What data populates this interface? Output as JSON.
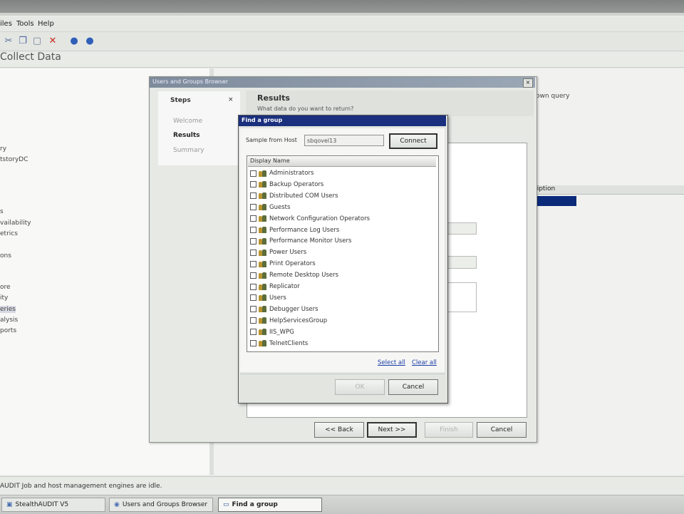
{
  "menu": {
    "items": [
      "iles",
      "Tools",
      "Help"
    ]
  },
  "toolbar": {
    "icons": [
      "cut-icon",
      "copy-icon",
      "paste-icon",
      "delete-icon",
      "back-circle-icon",
      "forward-circle-icon"
    ]
  },
  "page": {
    "title": "Collect Data"
  },
  "left_tree": {
    "items": [
      "ry",
      "tstoryDC",
      "s",
      "vailability",
      "etrics",
      "ons",
      "ore",
      "ity",
      "eries",
      "alysis",
      "ports"
    ]
  },
  "right_panel": {
    "snippet": "own query",
    "header_label": "ription"
  },
  "wizard": {
    "title": "Users and Groups Browser",
    "close_glyph": "×",
    "steps_header": "Steps",
    "steps_close": "×",
    "steps": [
      "Welcome",
      "Results",
      "Summary"
    ],
    "results_heading": "Results",
    "results_sub": "What data do you want to return?",
    "buttons": {
      "back": "<< Back",
      "next": "Next >>",
      "finish": "Finish",
      "cancel": "Cancel"
    }
  },
  "find_group": {
    "title": "Find a group",
    "host_label": "Sample from Host",
    "host_value": "sbqovel13",
    "connect_label": "Connect",
    "list_header": "Display Name",
    "groups": [
      "Administrators",
      "Backup Operators",
      "Distributed COM Users",
      "Guests",
      "Network Configuration Operators",
      "Performance Log Users",
      "Performance Monitor Users",
      "Power Users",
      "Print Operators",
      "Remote Desktop Users",
      "Replicator",
      "Users",
      "Debugger Users",
      "HelpServicesGroup",
      "IIS_WPG",
      "TelnetClients"
    ],
    "select_all": "Select all",
    "clear_all": "Clear all",
    "ok_label": "OK",
    "cancel_label": "Cancel"
  },
  "status": {
    "text": "AUDIT Job and host management engines are idle."
  },
  "taskbar": {
    "items": [
      {
        "label": "StealthAUDIT V5",
        "active": false
      },
      {
        "label": "Users and Groups Browser",
        "active": false
      },
      {
        "label": "Find a group",
        "active": true
      }
    ]
  }
}
